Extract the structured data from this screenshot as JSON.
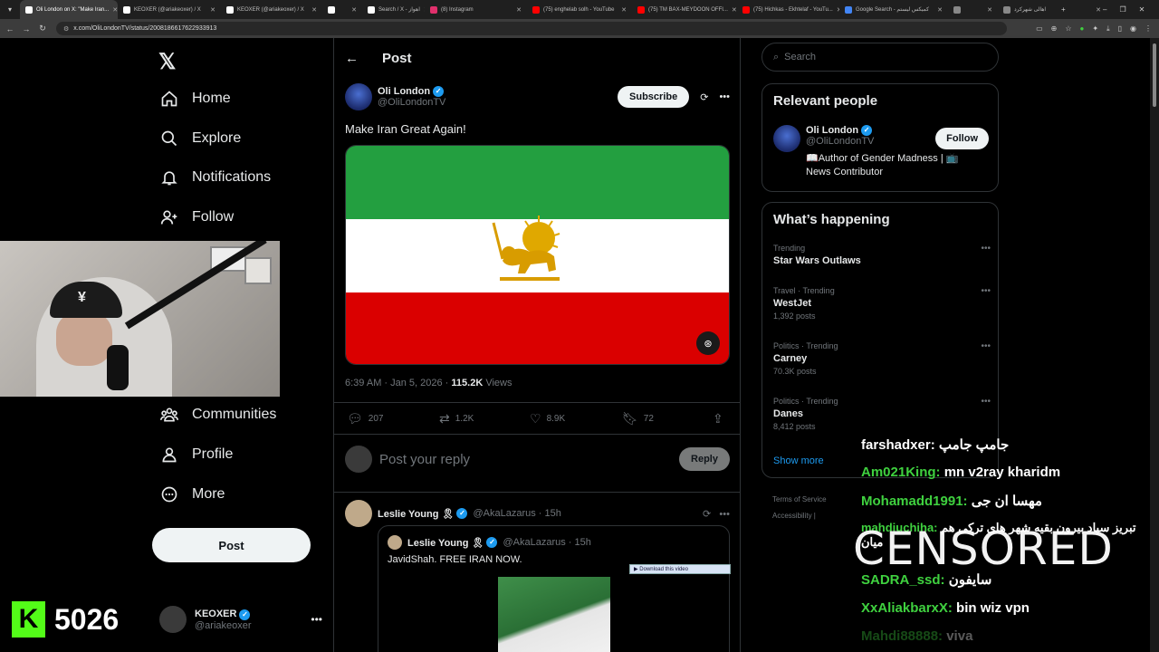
{
  "browser": {
    "tabs": [
      {
        "label": "Oli London on X: \"Make Iran...",
        "active": true,
        "color": "#ffffff"
      },
      {
        "label": "KEOXER (@ariakeoxer) / X",
        "active": false,
        "color": "#ffffff"
      },
      {
        "label": "KEOXER (@ariakeoxer) / X",
        "active": false,
        "color": "#ffffff"
      },
      {
        "label": "",
        "active": false,
        "color": "#ffffff"
      },
      {
        "label": "Search / X - اهواز",
        "active": false,
        "color": "#ffffff"
      },
      {
        "label": "(8) Instagram",
        "active": false,
        "color": "#e1306c"
      },
      {
        "label": "(75) enghelab solh - YouTube",
        "active": false,
        "color": "#ff0000"
      },
      {
        "label": "(75) TM BAX-MEYDOON OFFI...",
        "active": false,
        "color": "#ff0000"
      },
      {
        "label": "(75) Hichkas - Ekhtelaf - YouTu...",
        "active": false,
        "color": "#ff0000"
      },
      {
        "label": "Google Search - کمیکس لیستم",
        "active": false,
        "color": "#4285f4"
      },
      {
        "label": "",
        "active": false,
        "color": "#888888"
      },
      {
        "label": "اهالی شهرکرد",
        "active": false,
        "color": "#888888"
      }
    ],
    "url": "x.com/OliLondonTV/status/2008186617622933913"
  },
  "nav": {
    "logo": "𝕏",
    "items": [
      {
        "icon": "home-icon",
        "label": "Home"
      },
      {
        "icon": "search-icon",
        "label": "Explore"
      },
      {
        "icon": "bell-icon",
        "label": "Notifications"
      },
      {
        "icon": "follow-icon",
        "label": "Follow"
      },
      {
        "icon": "communities-icon",
        "label": "Communities"
      },
      {
        "icon": "profile-icon",
        "label": "Profile"
      },
      {
        "icon": "more-icon",
        "label": "More"
      }
    ],
    "post_label": "Post",
    "account": {
      "name": "KEOXER",
      "handle": "@ariakeoxer"
    }
  },
  "kick": {
    "logo": "K",
    "count": "5026"
  },
  "main": {
    "title": "Post",
    "author": {
      "name": "Oli London",
      "handle": "@OliLondonTV"
    },
    "subscribe_label": "Subscribe",
    "text": "Make Iran Great Again!",
    "timestamp": "6:39 AM · Jan 5, 2026 · ",
    "views": "115.2K",
    "views_label": " Views",
    "stats": {
      "replies": "207",
      "reposts": "1.2K",
      "likes": "8.9K",
      "bookmarks": "72"
    },
    "reply_placeholder": "Post your reply",
    "reply_button": "Reply",
    "reply": {
      "name": "Leslie Young 🎗",
      "handle": "@AkaLazarus · 15h",
      "quote": {
        "name": "Leslie Young 🎗",
        "handle": "@AkaLazarus · 15h",
        "text": "JavidShah.  FREE IRAN NOW."
      }
    },
    "download_bar": "Download this video"
  },
  "right": {
    "search_placeholder": "Search",
    "relevant_title": "Relevant people",
    "person": {
      "name": "Oli London",
      "handle": "@OliLondonTV",
      "bio": "📖Author of Gender Madness | 📺 News Contributor",
      "follow_label": "Follow"
    },
    "happening_title": "What’s happening",
    "trends": [
      {
        "category": "Trending",
        "name": "Star Wars Outlaws",
        "count": ""
      },
      {
        "category": "Travel · Trending",
        "name": "WestJet",
        "count": "1,392 posts"
      },
      {
        "category": "Politics · Trending",
        "name": "Carney",
        "count": "70.3K posts"
      },
      {
        "category": "Politics · Trending",
        "name": "Danes",
        "count": "8,412 posts"
      }
    ],
    "show_more": "Show more",
    "footer1": "Terms of Service",
    "footer2": "Accessibility  |"
  },
  "chat": {
    "messages": [
      {
        "user": "farshadxer:",
        "text": " جامپ جامپ",
        "color": "#ffffff"
      },
      {
        "user": "Am021King:",
        "text": " mn v2ray kharidm",
        "color": "#3fd13f"
      },
      {
        "user": "Mohamadd1991:",
        "text": " مهسا ان جی",
        "color": "#3fd13f"
      },
      {
        "user": "mahdiuchiha:",
        "text": " تبریز سپاد بیرون بقیه شهر های ترکی هم میان",
        "color": "#3fd13f"
      },
      {
        "user": "SADRA_ssd:",
        "text": " سایفون",
        "color": "#3fd13f"
      },
      {
        "user": "XxAliakbarxX:",
        "text": " bin wiz vpn",
        "color": "#3fd13f"
      },
      {
        "user": "Mahdi88888:",
        "text": " viva",
        "color": "#3fd13f"
      }
    ],
    "censored": "CENSORED"
  }
}
